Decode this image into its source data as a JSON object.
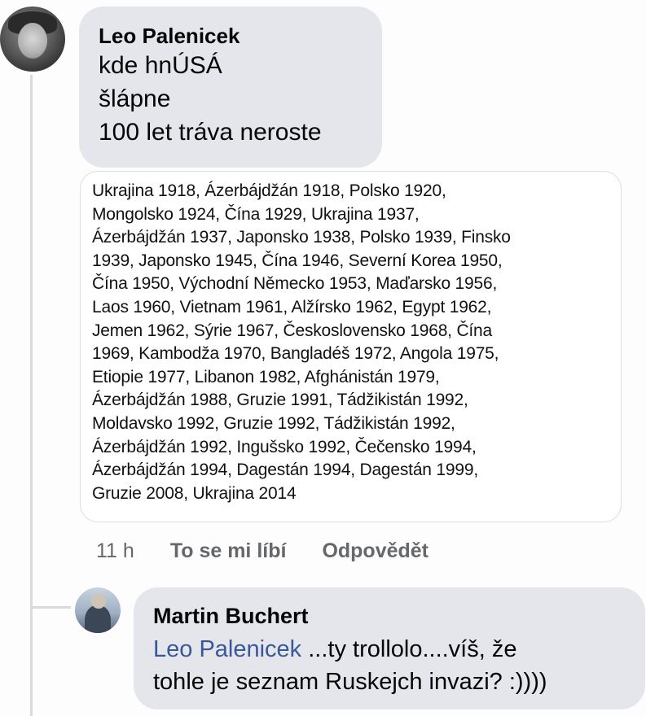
{
  "comment": {
    "author": "Leo Palenicek",
    "lines": [
      "kde hnÚSÁ",
      "šlápne",
      "100 let tráva neroste"
    ],
    "attachment_lines": [
      "Ukrajina 1918, Ázerbájdžán 1918, Polsko 1920,",
      "Mongolsko 1924, Čína 1929, Ukrajina 1937,",
      "Ázerbájdžán 1937, Japonsko 1938, Polsko 1939, Finsko",
      "1939, Japonsko 1945, Čína 1946, Severní Korea 1950,",
      "Čína 1950, Východní Německo 1953, Maďarsko 1956,",
      "Laos 1960, Vietnam 1961, Alžírsko 1962, Egypt 1962,",
      "Jemen 1962, Sýrie 1967, Československo 1968, Čína",
      "1969, Kambodža 1970, Bangladéš 1972, Angola 1975,",
      "Etiopie 1977, Libanon 1982, Afghánistán 1979,",
      "Ázerbájdžán 1988, Gruzie 1991, Tádžikistán 1992,",
      "Moldavsko 1992, Gruzie 1992, Tádžikistán 1992,",
      "Ázerbájdžán 1992, Ingušsko 1992, Čečensko 1994,",
      "Ázerbájdžán 1994, Dagestán 1994, Dagestán 1999,",
      "Gruzie 2008, Ukrajina 2014"
    ],
    "time": "11 h",
    "like_label": "To se mi líbí",
    "reply_label": "Odpovědět"
  },
  "reply": {
    "author": "Martin Buchert",
    "mention": "Leo Palenicek",
    "text_line1": " ...ty trollolo....víš, že",
    "text_line2": "tohle je seznam Ruskejch invazi? :))))"
  },
  "colors": {
    "bubble": "#e4e6eb",
    "mention": "#385898",
    "muted": "#65676b",
    "thread_line": "#d9dadc"
  }
}
